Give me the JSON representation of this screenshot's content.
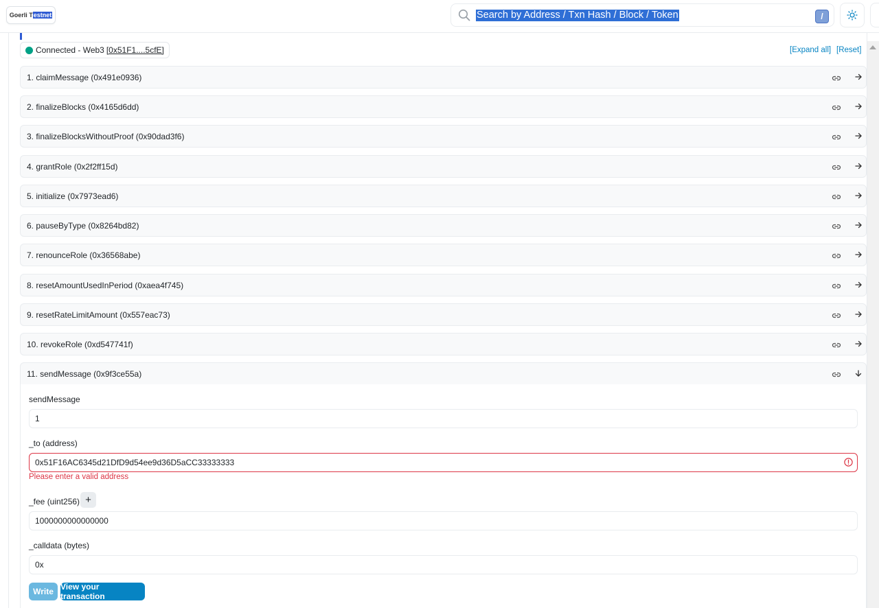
{
  "header": {
    "network_prefix": "Goerli T",
    "network_highlight": "estnet",
    "search_placeholder": "Search by Address / Txn Hash / Block / Token",
    "search_shortcut": "/"
  },
  "status": {
    "connected_label": "Connected - Web3",
    "address": "[0x51F1....5cfE]",
    "indicator_color": "#00a186"
  },
  "toolbar": {
    "expand_all": "[Expand all]",
    "reset": "[Reset]"
  },
  "functions": [
    {
      "label": "1. claimMessage (0x491e0936)"
    },
    {
      "label": "2. finalizeBlocks (0x4165d6dd)"
    },
    {
      "label": "3. finalizeBlocksWithoutProof (0x90dad3f6)"
    },
    {
      "label": "4. grantRole (0x2f2ff15d)"
    },
    {
      "label": "5. initialize (0x7973ead6)"
    },
    {
      "label": "6. pauseByType (0x8264bd82)"
    },
    {
      "label": "7. renounceRole (0x36568abe)"
    },
    {
      "label": "8. resetAmountUsedInPeriod (0xaea4f745)"
    },
    {
      "label": "9. resetRateLimitAmount (0x557eac73)"
    },
    {
      "label": "10. revokeRole (0xd547741f)"
    },
    {
      "label": "11. sendMessage (0x9f3ce55a)"
    }
  ],
  "form": {
    "payable_label": "sendMessage",
    "payable_value": "1",
    "to_label": "_to (address)",
    "to_value": "0x51F16AC6345d21DfD9d54ee9d36D5aCC33333333",
    "to_error": "Please enter a valid address",
    "fee_label": "_fee (uint256)",
    "fee_plus": "+",
    "fee_value": "1000000000000000",
    "calldata_label": "_calldata (bytes)",
    "calldata_value": "0x",
    "write_button": "Write",
    "view_button": "View your transaction"
  },
  "colors": {
    "link": "#0784c3",
    "error": "#dc3545",
    "accent": "#2f5bd3"
  }
}
